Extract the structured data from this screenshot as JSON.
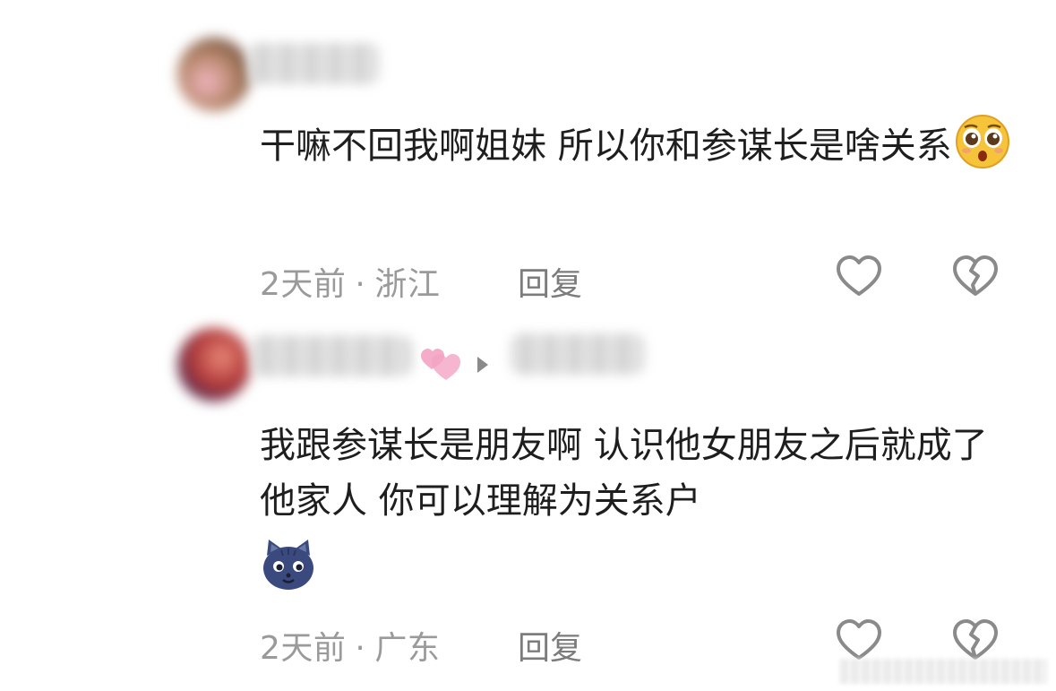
{
  "comments": [
    {
      "text": "干嘛不回我啊姐妹 所以你和参谋长是啥关系",
      "emoji": "pleading-face",
      "time": "2天前",
      "location": "浙江",
      "reply_label": "回复"
    },
    {
      "text": "我跟参谋长是朋友啊 认识他女朋友之后就成了他家人 你可以理解为关系户",
      "emoji": "cat-face",
      "time": "2天前",
      "location": "广东",
      "reply_label": "回复"
    }
  ],
  "separator": "·",
  "colors": {
    "text": "#1e1e1e",
    "meta": "#9a9a9a",
    "icon": "#8a8a8a",
    "emoji_yellow": "#f6c43a",
    "cat": "#3b4a7e"
  }
}
